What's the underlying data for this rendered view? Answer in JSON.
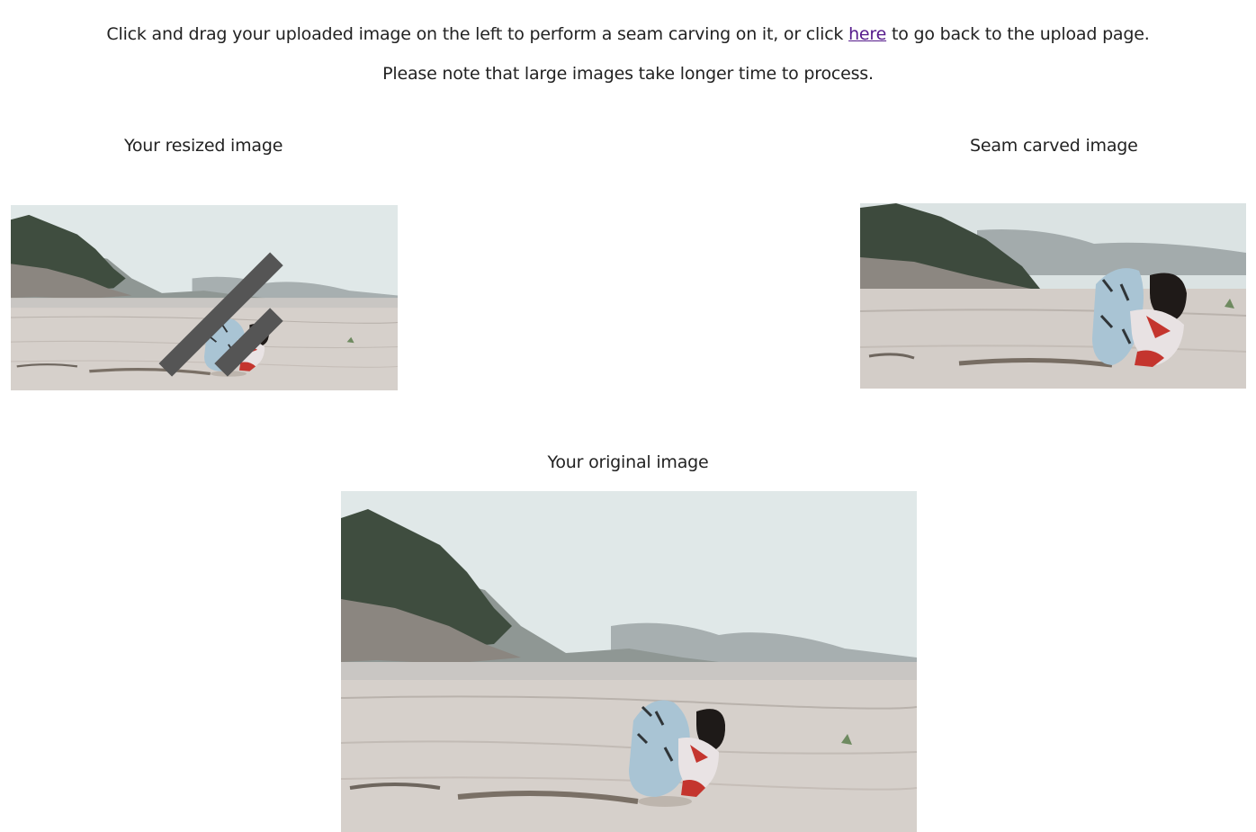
{
  "instructions": {
    "before_link": "Click and drag your uploaded image on the left to perform a seam carving on it, or click ",
    "link_label": "here",
    "after_link": " to go back to the upload page.",
    "note": "Please note that large images take longer time to process."
  },
  "resized": {
    "caption": "Your resized image"
  },
  "carved": {
    "caption": "Seam carved image"
  },
  "original": {
    "caption": "Your original image"
  },
  "colors": {
    "link": "#551a8b",
    "text": "#222222",
    "sky": "#dfe7e7",
    "sand": "#cfc7c1"
  }
}
